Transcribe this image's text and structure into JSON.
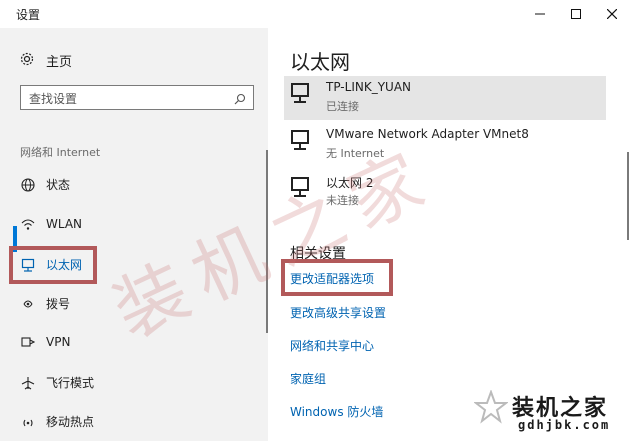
{
  "window": {
    "title": "设置"
  },
  "sidebar": {
    "home_label": "主页",
    "search_placeholder": "查找设置",
    "section_label": "网络和 Internet",
    "items": [
      {
        "label": "状态",
        "icon": "globe-icon"
      },
      {
        "label": "WLAN",
        "icon": "wifi-icon"
      },
      {
        "label": "以太网",
        "icon": "ethernet-icon",
        "active": true
      },
      {
        "label": "拨号",
        "icon": "dialup-icon"
      },
      {
        "label": "VPN",
        "icon": "vpn-icon"
      },
      {
        "label": "飞行模式",
        "icon": "airplane-icon"
      },
      {
        "label": "移动热点",
        "icon": "hotspot-icon"
      }
    ]
  },
  "main": {
    "page_title": "以太网",
    "adapters": [
      {
        "name": "TP-LINK_YUAN",
        "status": "已连接"
      },
      {
        "name": "VMware Network Adapter VMnet8",
        "status": "无 Internet"
      },
      {
        "name": "以太网 2",
        "status": "未连接"
      }
    ],
    "related_heading": "相关设置",
    "links": [
      "更改适配器选项",
      "更改高级共享设置",
      "网络和共享中心",
      "家庭组",
      "Windows 防火墙"
    ]
  },
  "watermark": {
    "text": "装机之家",
    "url": "gdhjbk.com"
  },
  "colors": {
    "accent": "#0078d7",
    "link": "#0063b1",
    "highlight_box": "#b2595a"
  }
}
